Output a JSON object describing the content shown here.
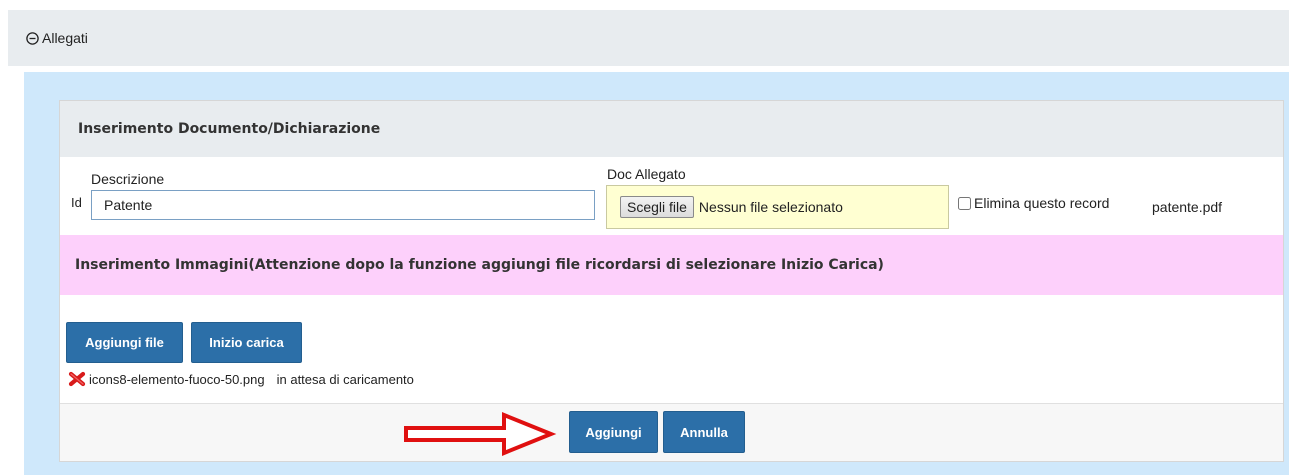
{
  "section": {
    "title": "Allegati"
  },
  "doc_panel": {
    "title": "Inserimento Documento/Dichiarazione",
    "id_label": "Id",
    "descrizione_label": "Descrizione",
    "descrizione_value": "Patente",
    "doc_allegato_label": "Doc Allegato",
    "choose_file_label": "Scegli file",
    "no_file_text": "Nessun file selezionato",
    "delete_checkbox_label": "Elimina questo record",
    "attached_filename": "patente.pdf"
  },
  "images_panel": {
    "title": "Inserimento Immagini(Attenzione dopo la funzione aggiungi file ricordarsi di selezionare Inizio Carica)",
    "add_file_label": "Aggiungi file",
    "start_upload_label": "Inizio carica",
    "queued_file": {
      "name": "icons8-elemento-fuoco-50.png",
      "status": "in attesa di caricamento",
      "remove_icon": "red-x-icon"
    }
  },
  "footer": {
    "aggiungi_label": "Aggiungi",
    "annulla_label": "Annulla",
    "pointer_icon": "red-arrow-icon"
  },
  "colors": {
    "primary_button": "#2c6fa8",
    "outer_bg": "#cfe8fb",
    "header_bg": "#e8ecef",
    "images_bg": "#fdd0fb",
    "file_bg": "#ffffd2",
    "arrow": "#e01010"
  }
}
